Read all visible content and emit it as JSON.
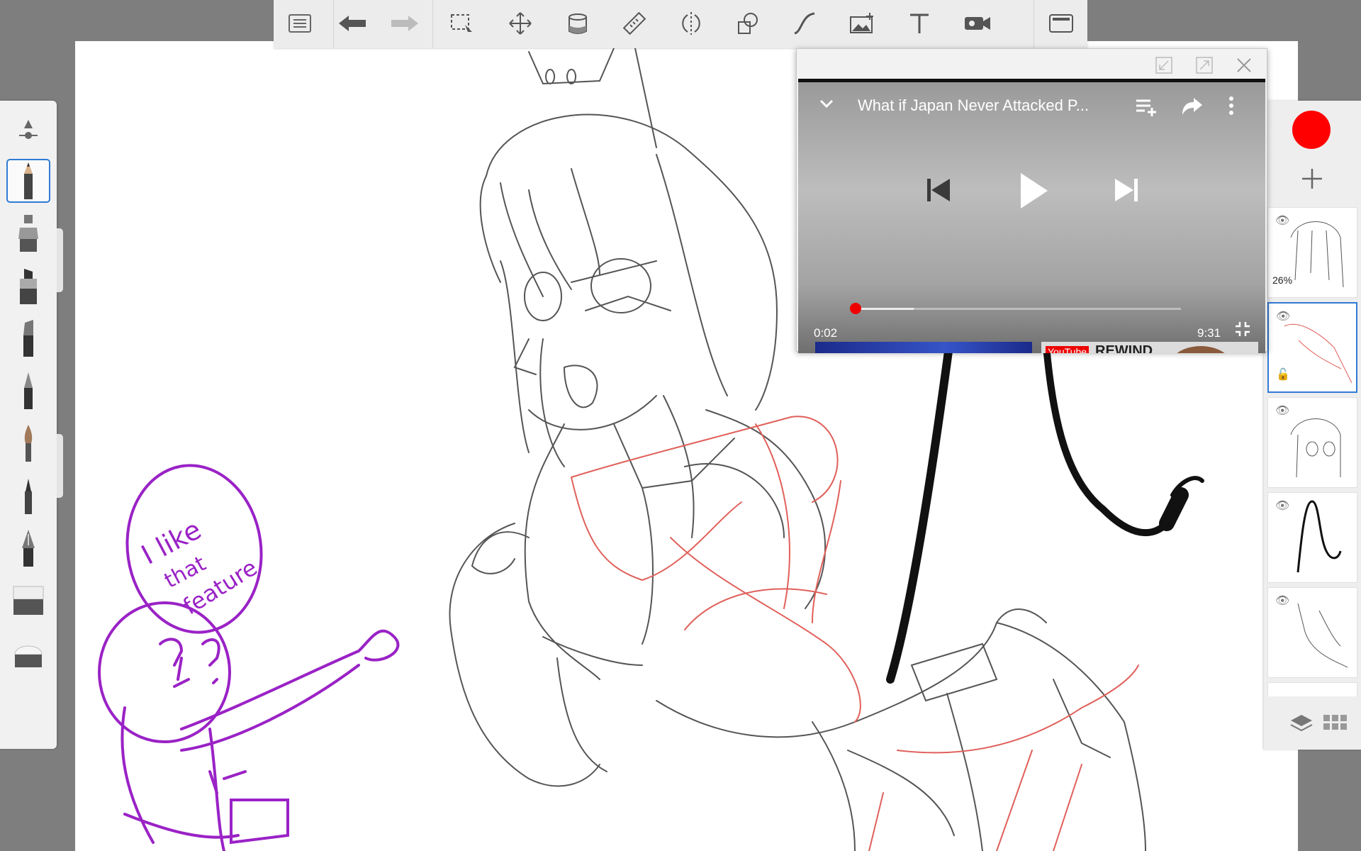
{
  "toolbar": {
    "items": [
      "list-icon",
      "undo-icon",
      "redo-icon",
      "selection-icon",
      "transform-icon",
      "fill-icon",
      "ruler-icon",
      "symmetry-icon",
      "shapes-icon",
      "stroke-icon",
      "image-icon",
      "text-icon",
      "record-icon",
      "fullscreen-icon"
    ]
  },
  "brushes": [
    "brush-size-icon",
    "pencil-icon",
    "airbrush-icon",
    "marker-icon",
    "chisel-icon",
    "ballpoint-icon",
    "paintbrush-icon",
    "fineliner-icon",
    "fountain-pen-icon",
    "smudge-icon",
    "eraser-icon"
  ],
  "layers": {
    "current_color": "#ff0000",
    "items": [
      {
        "opacity_label": "26%"
      },
      {
        "opacity_label": ""
      },
      {
        "opacity_label": ""
      },
      {
        "opacity_label": ""
      },
      {
        "opacity_label": ""
      }
    ]
  },
  "video": {
    "title": "What if Japan Never Attacked P...",
    "current_time": "0:02",
    "duration": "9:31",
    "progress": 0.003,
    "buffered": 0.18,
    "related_label": "REWIND",
    "related_brand": "YouTube"
  },
  "doodle": {
    "bubble_text": [
      "I like",
      "that",
      "feature"
    ]
  },
  "colors": {
    "sketch": "#444444",
    "red_lines": "#e0605a",
    "doodle": "#9a22c6",
    "accent": "#2f7bd6"
  }
}
